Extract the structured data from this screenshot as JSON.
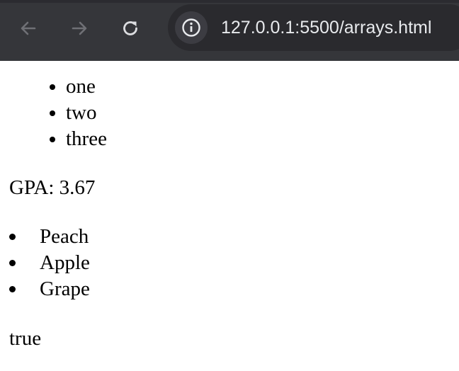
{
  "browser": {
    "url": "127.0.0.1:5500/arrays.html",
    "icons": {
      "back": "arrow-left-icon",
      "forward": "arrow-right-icon",
      "reload": "reload-icon",
      "site_info": "info-icon"
    }
  },
  "page": {
    "list_one": [
      "one",
      "two",
      "three"
    ],
    "gpa_text": "GPA: 3.67",
    "fruits": [
      "Peach",
      "Apple",
      "Grape"
    ],
    "result_text": "true"
  }
}
